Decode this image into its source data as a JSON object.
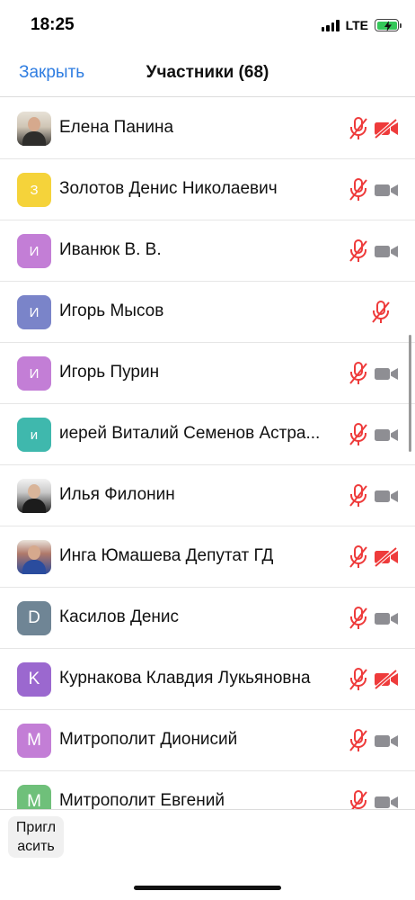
{
  "status_bar": {
    "time": "18:25",
    "network": "LTE"
  },
  "nav": {
    "close_label": "Закрыть",
    "title": "Участники (68)"
  },
  "participants": [
    {
      "name": "Елена Панина",
      "avatar_letter": "",
      "avatar_color": "",
      "avatar_type": "photo",
      "mic_muted": true,
      "video_off": true
    },
    {
      "name": "Золотов Денис Николаевич",
      "avatar_letter": "З",
      "avatar_color": "#f5d33a",
      "avatar_type": "letter",
      "mic_muted": true,
      "video_off": false
    },
    {
      "name": "Иванюк В. В.",
      "avatar_letter": "И",
      "avatar_color": "#c37ed6",
      "avatar_type": "letter",
      "mic_muted": true,
      "video_off": false
    },
    {
      "name": "Игорь Мысов",
      "avatar_letter": "И",
      "avatar_color": "#7a84c9",
      "avatar_type": "letter",
      "mic_muted": true,
      "video_off": null
    },
    {
      "name": "Игорь Пурин",
      "avatar_letter": "И",
      "avatar_color": "#c37ed6",
      "avatar_type": "letter",
      "mic_muted": true,
      "video_off": false
    },
    {
      "name": "иерей Виталий Семенов Астра...",
      "avatar_letter": "и",
      "avatar_color": "#3fb8ad",
      "avatar_type": "letter",
      "mic_muted": true,
      "video_off": false
    },
    {
      "name": "Илья Филонин",
      "avatar_letter": "",
      "avatar_color": "",
      "avatar_type": "photo",
      "mic_muted": true,
      "video_off": false
    },
    {
      "name": "Инга Юмашева Депутат ГД",
      "avatar_letter": "",
      "avatar_color": "",
      "avatar_type": "photo",
      "mic_muted": true,
      "video_off": true
    },
    {
      "name": "Касилов Денис",
      "avatar_letter": "D",
      "avatar_color": "#6f8595",
      "avatar_type": "letter",
      "mic_muted": true,
      "video_off": false
    },
    {
      "name": "Курнакова Клавдия Лукьяновна",
      "avatar_letter": "K",
      "avatar_color": "#9b68cf",
      "avatar_type": "letter",
      "mic_muted": true,
      "video_off": true
    },
    {
      "name": "Митрополит Дионисий",
      "avatar_letter": "M",
      "avatar_color": "#c37ed6",
      "avatar_type": "letter",
      "mic_muted": true,
      "video_off": false
    },
    {
      "name": "Митрополит Евгений",
      "avatar_letter": "M",
      "avatar_color": "#6fc07a",
      "avatar_type": "letter",
      "mic_muted": true,
      "video_off": false
    }
  ],
  "bottom": {
    "invite_label_line1": "Пригл",
    "invite_label_line2": "асить"
  },
  "colors": {
    "accent": "#2f7de1",
    "muted_red": "#ee3b3b",
    "icon_gray": "#8e8e93"
  }
}
